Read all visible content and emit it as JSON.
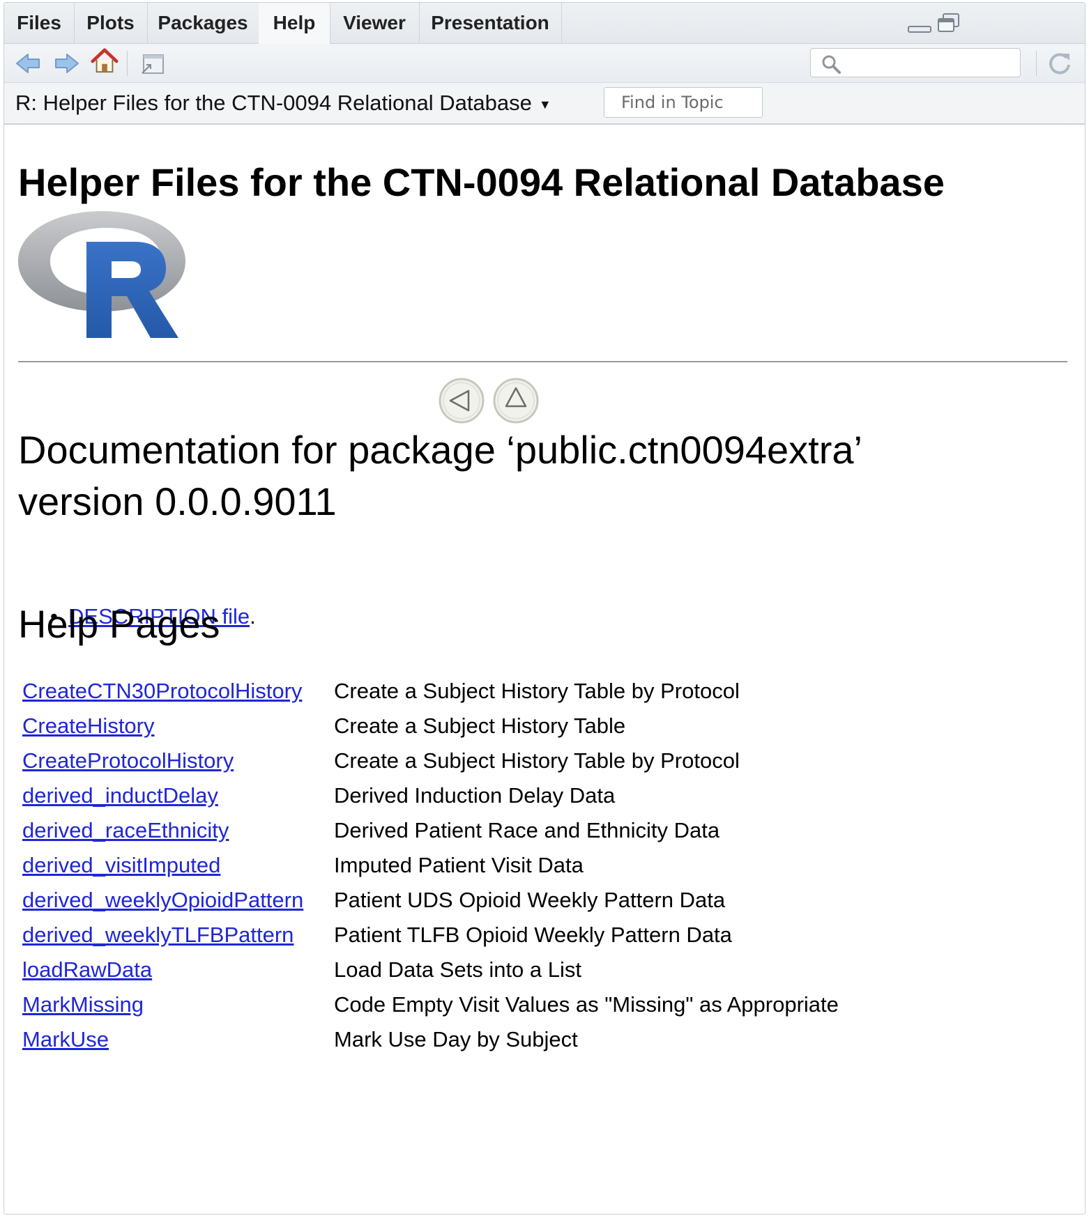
{
  "tabs": [
    {
      "label": "Files",
      "active": false
    },
    {
      "label": "Plots",
      "active": false
    },
    {
      "label": "Packages",
      "active": false
    },
    {
      "label": "Help",
      "active": true
    },
    {
      "label": "Viewer",
      "active": false
    },
    {
      "label": "Presentation",
      "active": false
    }
  ],
  "toolbar": {
    "back_icon": "back-arrow-icon",
    "forward_icon": "forward-arrow-icon",
    "home_icon": "home-icon",
    "popout_icon": "popout-icon",
    "search_icon": "search-icon",
    "refresh_icon": "refresh-icon",
    "search_value": ""
  },
  "topic_bar": {
    "title": "R: Helper Files for the CTN-0094 Relational Database",
    "find_placeholder": "Find in Topic"
  },
  "content": {
    "heading": "Helper Files for the CTN-0094 Relational Database",
    "logo_icon": "r-logo",
    "doc_title_line1": "Documentation for package ‘public.ctn0094extra’",
    "doc_title_line2": "version 0.0.0.9011",
    "description_link": "DESCRIPTION file",
    "description_suffix": ".",
    "help_pages_heading": "Help Pages",
    "help_pages": [
      {
        "name": "CreateCTN30ProtocolHistory",
        "desc": "Create a Subject History Table by Protocol"
      },
      {
        "name": "CreateHistory",
        "desc": "Create a Subject History Table"
      },
      {
        "name": "CreateProtocolHistory",
        "desc": "Create a Subject History Table by Protocol"
      },
      {
        "name": "derived_inductDelay",
        "desc": "Derived Induction Delay Data"
      },
      {
        "name": "derived_raceEthnicity",
        "desc": "Derived Patient Race and Ethnicity Data"
      },
      {
        "name": "derived_visitImputed",
        "desc": "Imputed Patient Visit Data"
      },
      {
        "name": "derived_weeklyOpioidPattern",
        "desc": "Patient UDS Opioid Weekly Pattern Data"
      },
      {
        "name": "derived_weeklyTLFBPattern",
        "desc": "Patient TLFB Opioid Weekly Pattern Data"
      },
      {
        "name": "loadRawData",
        "desc": "Load Data Sets into a List"
      },
      {
        "name": "MarkMissing",
        "desc": "Code Empty Visit Values as \"Missing\" as Appropriate"
      },
      {
        "name": "MarkUse",
        "desc": "Mark Use Day by Subject"
      }
    ]
  },
  "colors": {
    "link": "#1f26d6",
    "r_logo_blue": "#2c62b8",
    "r_logo_ring": "#9fa2a6",
    "home_roof": "#c8342a"
  }
}
